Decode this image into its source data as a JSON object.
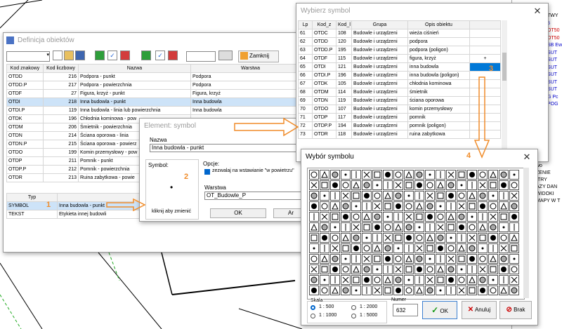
{
  "background": {
    "right_panel_lines": [
      "TWY",
      "5",
      "OT50",
      "OT50",
      "SB Ew",
      "SUT",
      "SUT",
      "SUT",
      "SUT",
      "SUT",
      "SUT",
      "G Pc",
      "POG"
    ],
    "right_panel_bottom": [
      "wo",
      "ŻENIE",
      "ITRY",
      "AZY DAN",
      "WIDOKI",
      "MAPY W T"
    ]
  },
  "definicja": {
    "title": "Definicja obiektów",
    "close_label": "Zamknij",
    "columns": [
      "Kod znakowy",
      "Kod liczbowy",
      "Nazwa",
      "Warstwa"
    ],
    "rows": [
      [
        "OTDD",
        "216",
        "Podpora - punkt",
        "Podpora"
      ],
      [
        "OTDD.P",
        "217",
        "Podpora - powierzchnia",
        "Podpora"
      ],
      [
        "OTDF",
        "27",
        "Figura, krzyż - punkt",
        "Figura, krzyż"
      ],
      [
        "OTDI",
        "218",
        "Inna budowla - punkt",
        "Inna budowla"
      ],
      [
        "OTDI.P",
        "119",
        "Inna budowla - linia lub powierzchnia",
        "Inna budowla"
      ],
      [
        "OTDK",
        "196",
        "Chłodnia kominowa - pow",
        ""
      ],
      [
        "OTDM",
        "206",
        "Śmietnik - powierzchnia",
        ""
      ],
      [
        "OTDN",
        "214",
        "Ściana oporowa - linia",
        ""
      ],
      [
        "OTDN.P",
        "215",
        "Ściana oporowa - powierz",
        ""
      ],
      [
        "OTDO",
        "199",
        "Komin przemysłowy - pow",
        ""
      ],
      [
        "OTDP",
        "211",
        "Pomnik - punkt",
        ""
      ],
      [
        "OTDP.P",
        "212",
        "Pomnik - powierzchnia",
        ""
      ],
      [
        "OTDR",
        "213",
        "Ruina zabytkowa - powie",
        ""
      ]
    ],
    "sub_columns": [
      "Typ",
      ""
    ],
    "sub_rows": [
      [
        "SYMBOL",
        "Inna budowla - punkt"
      ],
      [
        "TEKST",
        "Etykieta innej budowli"
      ]
    ]
  },
  "element": {
    "title": "Element: symbol",
    "name_label": "Nazwa",
    "name_value": "Inna budowla - punkt",
    "symbol_label": "Symbol:",
    "symbol_hint": "kliknij aby zmienić",
    "options_label": "Opcje:",
    "option_text": "zezwalaj na wstawianie \"w powietrzu\"",
    "layer_label": "Warstwa",
    "layer_value": "OT_Budowle_P",
    "ok_label": "OK",
    "cancel_label": "Ar"
  },
  "wybierz": {
    "title": "Wybierz symbol",
    "columns": [
      "Lp",
      "Kod_z",
      "Kod_l",
      "Grupa",
      "Opis obiektu",
      ""
    ],
    "rows": [
      [
        "61",
        "OTDC",
        "108",
        "Budowle i urządzeni",
        "wieża ciśnień",
        ""
      ],
      [
        "62",
        "OTDD",
        "120",
        "Budowle i urządzeni",
        "podpora",
        ""
      ],
      [
        "63",
        "OTDD.P",
        "195",
        "Budowle i urządzeni",
        "podpora (poligon)",
        ""
      ],
      [
        "64",
        "OTDF",
        "115",
        "Budowle i urządzeni",
        "figura, krzyż",
        "+"
      ],
      [
        "65",
        "OTDI",
        "121",
        "Budowle i urządzeni",
        "inna budowla",
        ""
      ],
      [
        "66",
        "OTDI.P",
        "196",
        "Budowle i urządzeni",
        "inna budowla (poligon)",
        ""
      ],
      [
        "67",
        "OTDK",
        "105",
        "Budowle i urządzeni",
        "chłodnia kominowa",
        ""
      ],
      [
        "68",
        "OTDM",
        "114",
        "Budowle i urządzeni",
        "śmietnik",
        ""
      ],
      [
        "69",
        "OTDN",
        "119",
        "Budowle i urządzeni",
        "ściana oporowa",
        ""
      ],
      [
        "70",
        "OTDO",
        "107",
        "Budowle i urządzeni",
        "komin przemysłowy",
        ""
      ],
      [
        "71",
        "OTDP",
        "117",
        "Budowle i urządzeni",
        "pomnik",
        ""
      ],
      [
        "72",
        "OTDP.P",
        "194",
        "Budowle i urządzeni",
        "pomnik (poligon)",
        ""
      ],
      [
        "73",
        "OTDR",
        "118",
        "Budowle i urządzeni",
        "ruina zabytkowa",
        ""
      ]
    ]
  },
  "wybor": {
    "title": "Wybór symbolu",
    "scale_label": "Skala",
    "scales": [
      "1 : 500",
      "1 : 1000",
      "1 : 2000",
      "1 : 5000"
    ],
    "number_label": "Numer",
    "number_value": "632",
    "ok_label": "OK",
    "cancel_label": "Anuluj",
    "none_label": "Brak"
  },
  "callouts": [
    "1",
    "2",
    "3",
    "4"
  ],
  "colors": {
    "accent": "#f08c2a",
    "selection": "#0078d7"
  }
}
